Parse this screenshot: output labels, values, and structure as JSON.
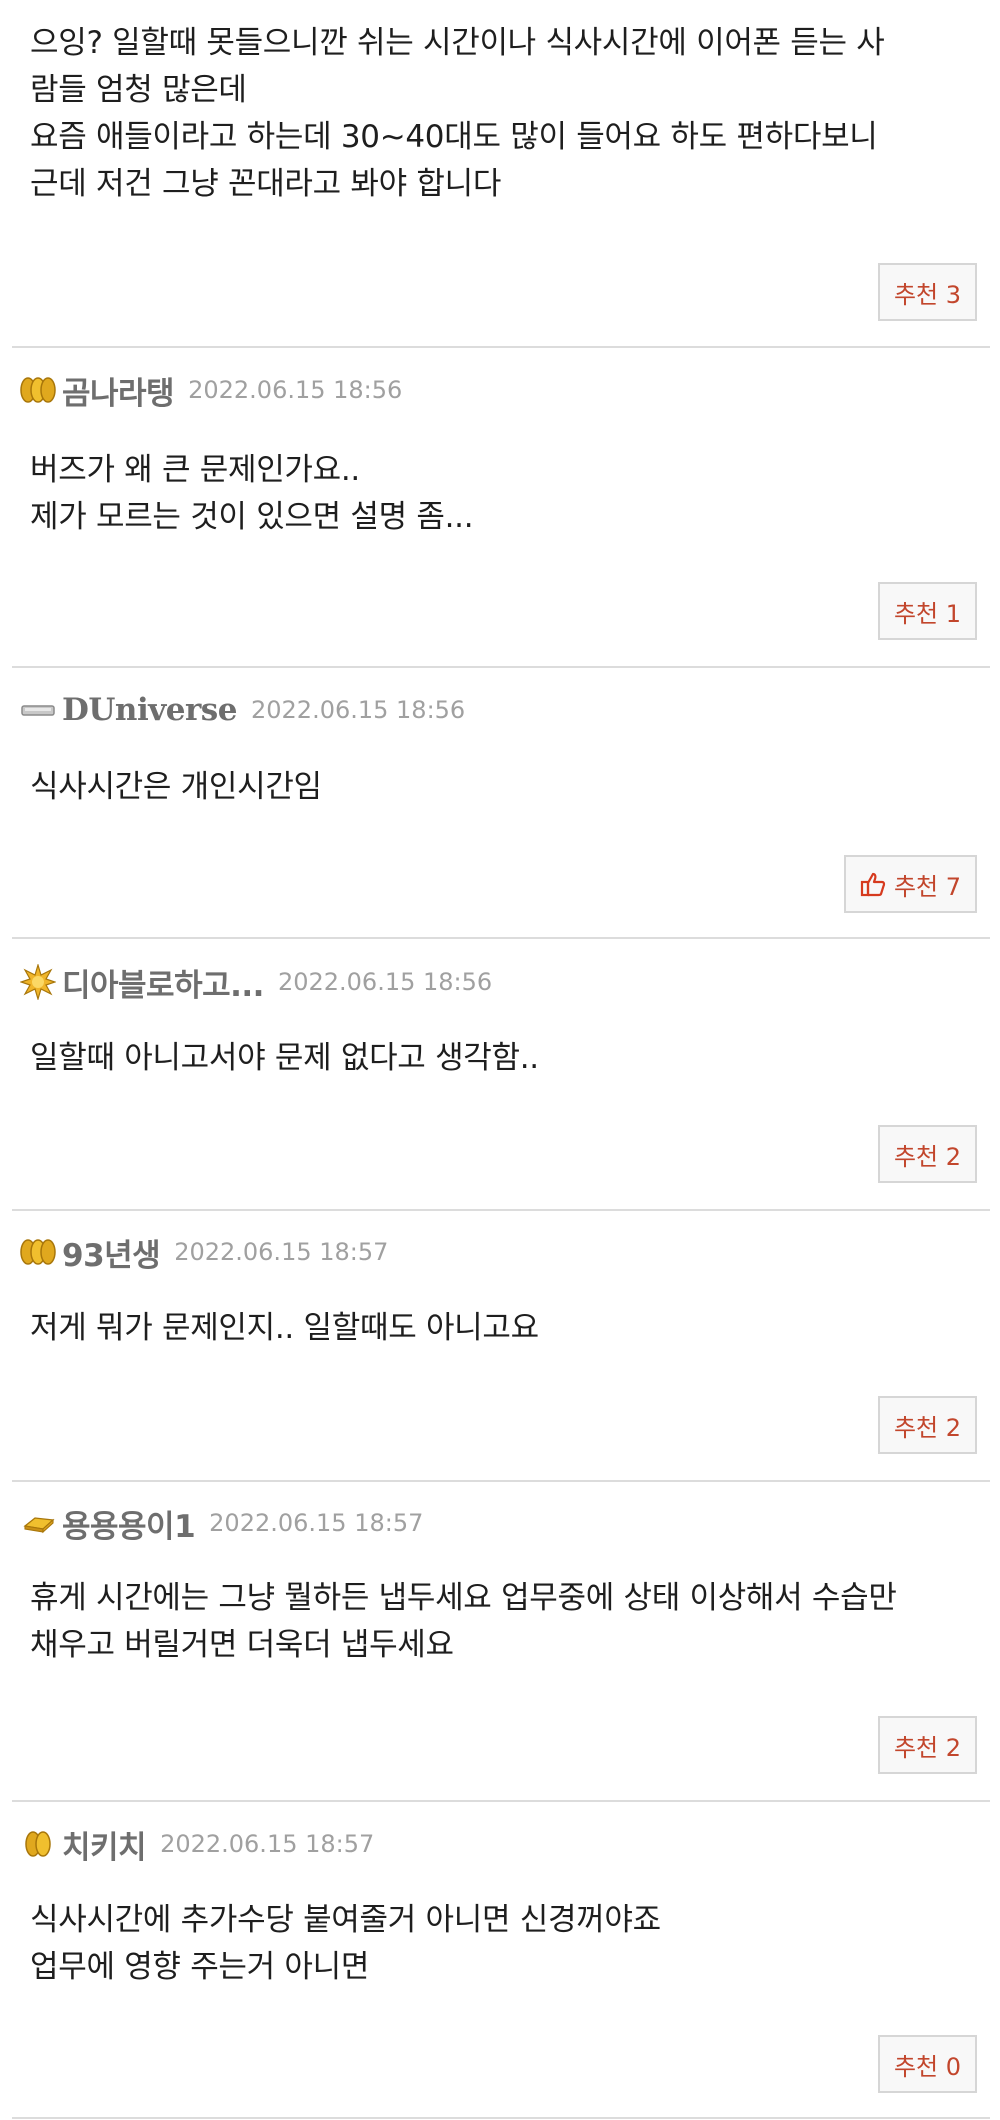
{
  "comments": [
    {
      "lines": [
        "으잉? 일할때 못들으니깐 쉬는 시간이나 식사시간에 이어폰 듣는 사",
        "람들 엄청 많은데",
        "요즘 애들이라고 하는데 30~40대도 많이 들어요 하도 편하다보니",
        "근데 저건 그냥 꼰대라고 봐야 합니다"
      ],
      "recommend": "추천 3"
    },
    {
      "nickname": "곰나라탱",
      "badge_icon": "triple-gold-coin-icon",
      "date": "2022.06.15 18:56",
      "lines": [
        "버즈가 왜 큰 문제인가요..",
        "제가 모르는 것이 있으면 설명 좀..."
      ],
      "recommend": "추천 1"
    },
    {
      "nickname": "DUniverse",
      "badge_icon": "silver-bar-icon",
      "date": "2022.06.15 18:56",
      "lines": [
        "식사시간은 개인시간임"
      ],
      "recommend": "추천 7",
      "recommend_icon": "thumbs-up-icon"
    },
    {
      "nickname": "디아블로하고...",
      "badge_icon": "gold-star-burst-icon",
      "date": "2022.06.15 18:56",
      "lines": [
        "일할때 아니고서야 문제 없다고 생각함.."
      ],
      "recommend": "추천 2"
    },
    {
      "nickname": "93년생",
      "badge_icon": "triple-gold-coin-icon",
      "date": "2022.06.15 18:57",
      "lines": [
        "저게 뭐가 문제인지.. 일할때도 아니고요"
      ],
      "recommend": "추천 2"
    },
    {
      "nickname": "용용용이1",
      "badge_icon": "gold-bar-icon",
      "date": "2022.06.15 18:57",
      "lines": [
        "휴게 시간에는 그냥 뭘하든 냅두세요 업무중에 상태 이상해서 수습만",
        "채우고 버릴거면 더욱더 냅두세요"
      ],
      "recommend": "추천 2"
    },
    {
      "nickname": "치키치",
      "badge_icon": "double-gold-coin-icon",
      "date": "2022.06.15 18:57",
      "lines": [
        "식사시간에 추가수당 붙여줄거 아니면 신경꺼야죠",
        "업무에 영향 주는거 아니면"
      ],
      "recommend": "추천 0"
    }
  ],
  "colors": {
    "recommend_text": "#c2462c",
    "nickname": "#6e6e6e",
    "date": "#a0a0a0",
    "divider": "#dcdcdc"
  }
}
